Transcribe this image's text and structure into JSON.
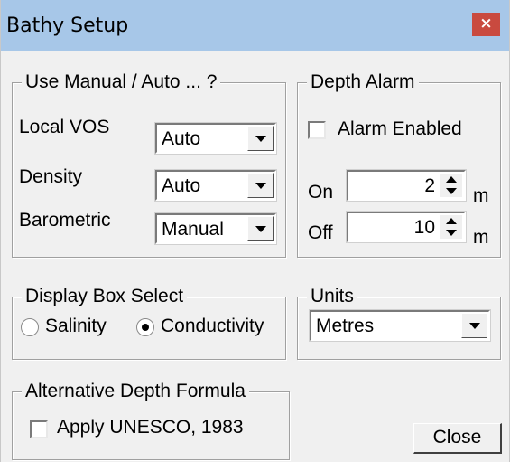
{
  "window": {
    "title": "Bathy Setup",
    "close_glyph": "×"
  },
  "manual_auto": {
    "legend": "Use Manual / Auto ... ?",
    "rows": [
      {
        "label": "Local VOS",
        "value": "Auto"
      },
      {
        "label": "Density",
        "value": "Auto"
      },
      {
        "label": "Barometric",
        "value": "Manual"
      }
    ]
  },
  "depth_alarm": {
    "legend": "Depth Alarm",
    "enabled_label": "Alarm Enabled",
    "enabled": false,
    "on_label": "On",
    "on_value": "2",
    "on_unit": "m",
    "off_label": "Off",
    "off_value": "10",
    "off_unit": "m"
  },
  "display_box": {
    "legend": "Display Box Select",
    "options": [
      "Salinity",
      "Conductivity"
    ],
    "selected": "Conductivity"
  },
  "units": {
    "legend": "Units",
    "value": "Metres"
  },
  "alt_formula": {
    "legend": "Alternative Depth Formula",
    "checkbox_label": "Apply UNESCO, 1983",
    "checked": false
  },
  "buttons": {
    "close": "Close"
  },
  "icons": {
    "close": "close-icon",
    "dropdown": "chevron-down-icon",
    "spin_up": "spin-up-icon",
    "spin_down": "spin-down-icon"
  },
  "colors": {
    "titlebar": "#a7c7e8",
    "close_button": "#c94a3f",
    "dialog": "#f0f0f0"
  }
}
